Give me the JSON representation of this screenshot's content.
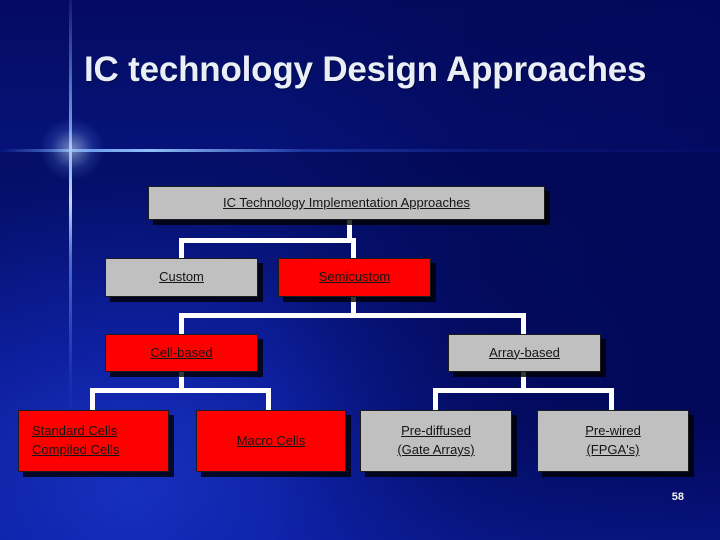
{
  "slide": {
    "title": "IC technology Design Approaches",
    "page_number": "58",
    "colors": {
      "background_blue": "#00008f",
      "gray_box": "#c0c0c0",
      "red_box": "#ff0000",
      "connector": "#ffffff",
      "title_text": "#e9eef7"
    }
  },
  "diagram": {
    "root": {
      "label": "IC Technology Implementation Approaches",
      "fill": "gray"
    },
    "level2": [
      {
        "label": "Custom",
        "fill": "gray"
      },
      {
        "label": "Semicustom",
        "fill": "red"
      }
    ],
    "level3": [
      {
        "label": "Cell-based",
        "fill": "red"
      },
      {
        "label": "Array-based",
        "fill": "gray"
      }
    ],
    "level4": [
      {
        "line1": "Standard Cells",
        "line2": "Compiled Cells",
        "fill": "red",
        "align": "left"
      },
      {
        "line1": "Macro Cells",
        "line2": "",
        "fill": "red",
        "align": "center"
      },
      {
        "line1": "Pre-diffused",
        "line2": "(Gate Arrays)",
        "fill": "gray",
        "align": "center"
      },
      {
        "line1": "Pre-wired",
        "line2": "(FPGA's)",
        "fill": "gray",
        "align": "center"
      }
    ]
  }
}
